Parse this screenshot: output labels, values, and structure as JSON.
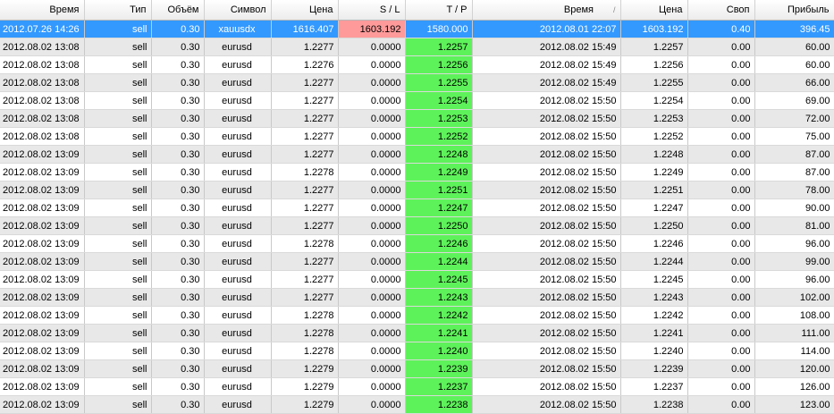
{
  "columns": {
    "open_time": "Время",
    "type": "Тип",
    "volume": "Объём",
    "symbol": "Символ",
    "open_price": "Цена",
    "sl": "S / L",
    "tp": "T / P",
    "close_time": "Время",
    "close_price": "Цена",
    "swap": "Своп",
    "profit": "Прибыль"
  },
  "sort_indicator": "/",
  "colors": {
    "selected_row": "#3399ff",
    "sl_triggered": "#ff9a9a",
    "tp_triggered": "#5ef25a"
  },
  "rows": [
    {
      "open_time": "2012.07.26 14:26",
      "type": "sell",
      "volume": "0.30",
      "symbol": "xauusdx",
      "open_price": "1616.407",
      "sl": "1603.192",
      "tp": "1580.000",
      "close_time": "2012.08.01 22:07",
      "close_price": "1603.192",
      "swap": "0.40",
      "profit": "396.45",
      "selected": true,
      "closed_by": "sl"
    },
    {
      "open_time": "2012.08.02 13:08",
      "type": "sell",
      "volume": "0.30",
      "symbol": "eurusd",
      "open_price": "1.2277",
      "sl": "0.0000",
      "tp": "1.2257",
      "close_time": "2012.08.02 15:49",
      "close_price": "1.2257",
      "swap": "0.00",
      "profit": "60.00",
      "closed_by": "tp"
    },
    {
      "open_time": "2012.08.02 13:08",
      "type": "sell",
      "volume": "0.30",
      "symbol": "eurusd",
      "open_price": "1.2276",
      "sl": "0.0000",
      "tp": "1.2256",
      "close_time": "2012.08.02 15:49",
      "close_price": "1.2256",
      "swap": "0.00",
      "profit": "60.00",
      "closed_by": "tp"
    },
    {
      "open_time": "2012.08.02 13:08",
      "type": "sell",
      "volume": "0.30",
      "symbol": "eurusd",
      "open_price": "1.2277",
      "sl": "0.0000",
      "tp": "1.2255",
      "close_time": "2012.08.02 15:49",
      "close_price": "1.2255",
      "swap": "0.00",
      "profit": "66.00",
      "closed_by": "tp"
    },
    {
      "open_time": "2012.08.02 13:08",
      "type": "sell",
      "volume": "0.30",
      "symbol": "eurusd",
      "open_price": "1.2277",
      "sl": "0.0000",
      "tp": "1.2254",
      "close_time": "2012.08.02 15:50",
      "close_price": "1.2254",
      "swap": "0.00",
      "profit": "69.00",
      "closed_by": "tp"
    },
    {
      "open_time": "2012.08.02 13:08",
      "type": "sell",
      "volume": "0.30",
      "symbol": "eurusd",
      "open_price": "1.2277",
      "sl": "0.0000",
      "tp": "1.2253",
      "close_time": "2012.08.02 15:50",
      "close_price": "1.2253",
      "swap": "0.00",
      "profit": "72.00",
      "closed_by": "tp"
    },
    {
      "open_time": "2012.08.02 13:08",
      "type": "sell",
      "volume": "0.30",
      "symbol": "eurusd",
      "open_price": "1.2277",
      "sl": "0.0000",
      "tp": "1.2252",
      "close_time": "2012.08.02 15:50",
      "close_price": "1.2252",
      "swap": "0.00",
      "profit": "75.00",
      "closed_by": "tp"
    },
    {
      "open_time": "2012.08.02 13:09",
      "type": "sell",
      "volume": "0.30",
      "symbol": "eurusd",
      "open_price": "1.2277",
      "sl": "0.0000",
      "tp": "1.2248",
      "close_time": "2012.08.02 15:50",
      "close_price": "1.2248",
      "swap": "0.00",
      "profit": "87.00",
      "closed_by": "tp"
    },
    {
      "open_time": "2012.08.02 13:09",
      "type": "sell",
      "volume": "0.30",
      "symbol": "eurusd",
      "open_price": "1.2278",
      "sl": "0.0000",
      "tp": "1.2249",
      "close_time": "2012.08.02 15:50",
      "close_price": "1.2249",
      "swap": "0.00",
      "profit": "87.00",
      "closed_by": "tp"
    },
    {
      "open_time": "2012.08.02 13:09",
      "type": "sell",
      "volume": "0.30",
      "symbol": "eurusd",
      "open_price": "1.2277",
      "sl": "0.0000",
      "tp": "1.2251",
      "close_time": "2012.08.02 15:50",
      "close_price": "1.2251",
      "swap": "0.00",
      "profit": "78.00",
      "closed_by": "tp"
    },
    {
      "open_time": "2012.08.02 13:09",
      "type": "sell",
      "volume": "0.30",
      "symbol": "eurusd",
      "open_price": "1.2277",
      "sl": "0.0000",
      "tp": "1.2247",
      "close_time": "2012.08.02 15:50",
      "close_price": "1.2247",
      "swap": "0.00",
      "profit": "90.00",
      "closed_by": "tp"
    },
    {
      "open_time": "2012.08.02 13:09",
      "type": "sell",
      "volume": "0.30",
      "symbol": "eurusd",
      "open_price": "1.2277",
      "sl": "0.0000",
      "tp": "1.2250",
      "close_time": "2012.08.02 15:50",
      "close_price": "1.2250",
      "swap": "0.00",
      "profit": "81.00",
      "closed_by": "tp"
    },
    {
      "open_time": "2012.08.02 13:09",
      "type": "sell",
      "volume": "0.30",
      "symbol": "eurusd",
      "open_price": "1.2278",
      "sl": "0.0000",
      "tp": "1.2246",
      "close_time": "2012.08.02 15:50",
      "close_price": "1.2246",
      "swap": "0.00",
      "profit": "96.00",
      "closed_by": "tp"
    },
    {
      "open_time": "2012.08.02 13:09",
      "type": "sell",
      "volume": "0.30",
      "symbol": "eurusd",
      "open_price": "1.2277",
      "sl": "0.0000",
      "tp": "1.2244",
      "close_time": "2012.08.02 15:50",
      "close_price": "1.2244",
      "swap": "0.00",
      "profit": "99.00",
      "closed_by": "tp"
    },
    {
      "open_time": "2012.08.02 13:09",
      "type": "sell",
      "volume": "0.30",
      "symbol": "eurusd",
      "open_price": "1.2277",
      "sl": "0.0000",
      "tp": "1.2245",
      "close_time": "2012.08.02 15:50",
      "close_price": "1.2245",
      "swap": "0.00",
      "profit": "96.00",
      "closed_by": "tp"
    },
    {
      "open_time": "2012.08.02 13:09",
      "type": "sell",
      "volume": "0.30",
      "symbol": "eurusd",
      "open_price": "1.2277",
      "sl": "0.0000",
      "tp": "1.2243",
      "close_time": "2012.08.02 15:50",
      "close_price": "1.2243",
      "swap": "0.00",
      "profit": "102.00",
      "closed_by": "tp"
    },
    {
      "open_time": "2012.08.02 13:09",
      "type": "sell",
      "volume": "0.30",
      "symbol": "eurusd",
      "open_price": "1.2278",
      "sl": "0.0000",
      "tp": "1.2242",
      "close_time": "2012.08.02 15:50",
      "close_price": "1.2242",
      "swap": "0.00",
      "profit": "108.00",
      "closed_by": "tp"
    },
    {
      "open_time": "2012.08.02 13:09",
      "type": "sell",
      "volume": "0.30",
      "symbol": "eurusd",
      "open_price": "1.2278",
      "sl": "0.0000",
      "tp": "1.2241",
      "close_time": "2012.08.02 15:50",
      "close_price": "1.2241",
      "swap": "0.00",
      "profit": "111.00",
      "closed_by": "tp"
    },
    {
      "open_time": "2012.08.02 13:09",
      "type": "sell",
      "volume": "0.30",
      "symbol": "eurusd",
      "open_price": "1.2278",
      "sl": "0.0000",
      "tp": "1.2240",
      "close_time": "2012.08.02 15:50",
      "close_price": "1.2240",
      "swap": "0.00",
      "profit": "114.00",
      "closed_by": "tp"
    },
    {
      "open_time": "2012.08.02 13:09",
      "type": "sell",
      "volume": "0.30",
      "symbol": "eurusd",
      "open_price": "1.2279",
      "sl": "0.0000",
      "tp": "1.2239",
      "close_time": "2012.08.02 15:50",
      "close_price": "1.2239",
      "swap": "0.00",
      "profit": "120.00",
      "closed_by": "tp"
    },
    {
      "open_time": "2012.08.02 13:09",
      "type": "sell",
      "volume": "0.30",
      "symbol": "eurusd",
      "open_price": "1.2279",
      "sl": "0.0000",
      "tp": "1.2237",
      "close_time": "2012.08.02 15:50",
      "close_price": "1.2237",
      "swap": "0.00",
      "profit": "126.00",
      "closed_by": "tp"
    },
    {
      "open_time": "2012.08.02 13:09",
      "type": "sell",
      "volume": "0.30",
      "symbol": "eurusd",
      "open_price": "1.2279",
      "sl": "0.0000",
      "tp": "1.2238",
      "close_time": "2012.08.02 15:50",
      "close_price": "1.2238",
      "swap": "0.00",
      "profit": "123.00",
      "closed_by": "tp"
    }
  ]
}
